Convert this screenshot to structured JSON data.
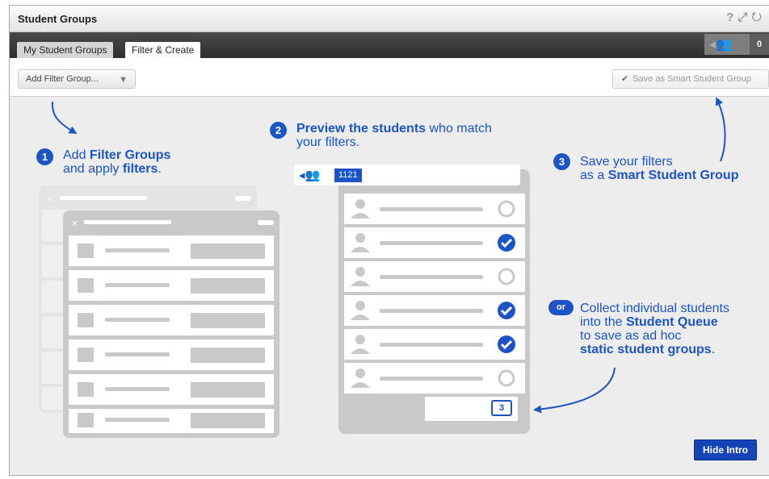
{
  "window": {
    "title": "Student Groups"
  },
  "titlebar_icons": [
    "help-icon",
    "expand-icon",
    "refresh-icon"
  ],
  "tabs": [
    {
      "label": "My Student Groups",
      "active": false
    },
    {
      "label": "Filter & Create",
      "active": true
    }
  ],
  "queue": {
    "count": "0",
    "icon": "student-queue-icon"
  },
  "toolbar": {
    "add_filter_label": "Add Filter Group...",
    "save_label": "Save as Smart Student Group",
    "save_enabled": false
  },
  "intro": {
    "step1": {
      "number": "1",
      "line1_pre": "Add ",
      "line1_bold": "Filter Groups",
      "line2_pre": "and apply ",
      "line2_bold": "filters",
      "line2_post": "."
    },
    "step2": {
      "number": "2",
      "line1_bold": "Preview the students",
      "line1_post": " who match",
      "line2": "your filters."
    },
    "step3": {
      "number": "3",
      "line1": "Save your filters",
      "line2_pre": "as a ",
      "line2_bold": "Smart Student Group"
    },
    "step_or": {
      "badge": "or",
      "line1": "Collect individual students",
      "line2_pre": "into the ",
      "line2_bold": "Student Queue",
      "line3": "to save as ad hoc",
      "line4_bold": "static student groups",
      "line4_post": "."
    },
    "preview_count": "1121",
    "preview_rows_checked": [
      false,
      true,
      false,
      true,
      true,
      false
    ],
    "queue_count": "3",
    "hide_label": "Hide Intro"
  },
  "colors": {
    "accent": "#1c54c8",
    "illustration": "#c9c9c9",
    "background": "#ededed"
  }
}
